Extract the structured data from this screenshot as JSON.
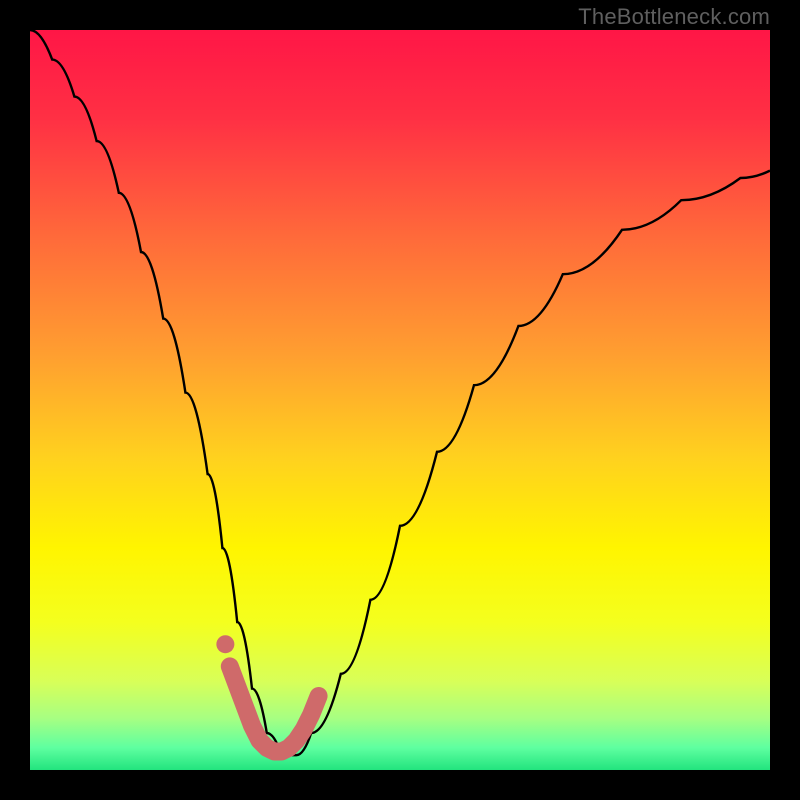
{
  "watermark": "TheBottleneck.com",
  "gradient": {
    "stops": [
      {
        "offset": 0.0,
        "color": "#ff1646"
      },
      {
        "offset": 0.12,
        "color": "#ff3044"
      },
      {
        "offset": 0.28,
        "color": "#ff6a3a"
      },
      {
        "offset": 0.44,
        "color": "#ff9f30"
      },
      {
        "offset": 0.58,
        "color": "#ffd21e"
      },
      {
        "offset": 0.7,
        "color": "#fff500"
      },
      {
        "offset": 0.8,
        "color": "#f4ff1e"
      },
      {
        "offset": 0.88,
        "color": "#d8ff58"
      },
      {
        "offset": 0.93,
        "color": "#a7ff82"
      },
      {
        "offset": 0.97,
        "color": "#5effa0"
      },
      {
        "offset": 1.0,
        "color": "#22e47e"
      }
    ]
  },
  "chart_data": {
    "type": "line",
    "title": "",
    "xlabel": "",
    "ylabel": "",
    "xlim": [
      0,
      100
    ],
    "ylim": [
      0,
      100
    ],
    "series": [
      {
        "name": "bottleneck-curve",
        "x": [
          0,
          3,
          6,
          9,
          12,
          15,
          18,
          21,
          24,
          26,
          28,
          30,
          32,
          34,
          36,
          38,
          42,
          46,
          50,
          55,
          60,
          66,
          72,
          80,
          88,
          96,
          100
        ],
        "y": [
          100,
          96,
          91,
          85,
          78,
          70,
          61,
          51,
          40,
          30,
          20,
          11,
          5,
          2,
          2,
          5,
          13,
          23,
          33,
          43,
          52,
          60,
          67,
          73,
          77,
          80,
          81
        ]
      }
    ],
    "highlight": {
      "name": "optimal-zone",
      "color": "#cf6a6a",
      "x": [
        27,
        28.5,
        30,
        31,
        32,
        33,
        34,
        35,
        36,
        37,
        38,
        39
      ],
      "y": [
        14,
        10,
        6,
        4,
        3,
        2.5,
        2.5,
        3,
        4,
        5.5,
        7.5,
        10
      ]
    }
  }
}
